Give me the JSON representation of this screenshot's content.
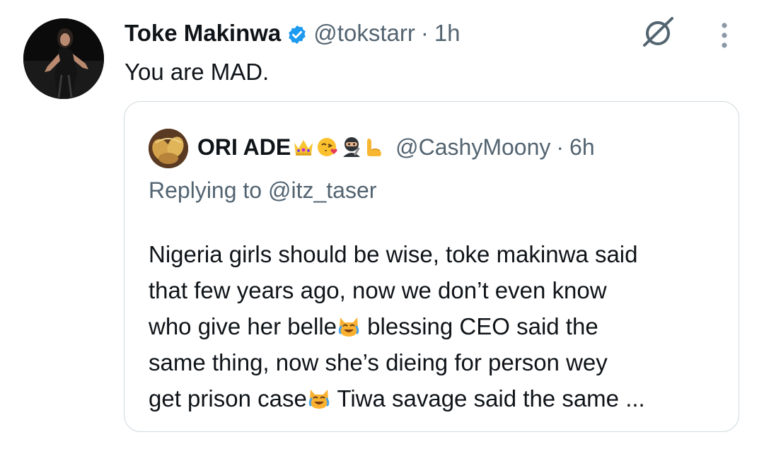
{
  "tweet": {
    "author_name": "Toke Makinwa",
    "handle": "@tokstarr",
    "separator": "·",
    "time": "1h",
    "text": "You are MAD.",
    "verified_color": "#1d9bf0",
    "icons": [
      "verified-badge-icon",
      "grok-icon",
      "more-options-icon"
    ]
  },
  "quote": {
    "author_name": "ORI ADE",
    "name_emojis": [
      "crown",
      "face-blowing-kiss",
      "ninja",
      "flexed-biceps"
    ],
    "handle": "@CashyMoony",
    "separator": "·",
    "time": "6h",
    "replying_prefix": "Replying to",
    "replying_handle": "@itz_taser",
    "lines": [
      {
        "text": "Nigeria girls should be wise, toke makinwa said"
      },
      {
        "text": "that few years ago, now we don’t even know"
      },
      {
        "before": "who give her belle",
        "emoji": "cat-with-tears-of-joy",
        "after": " blessing CEO said the"
      },
      {
        "text": "same thing, now she’s dieing for person wey"
      },
      {
        "before": "get prison case",
        "emoji": "cat-with-tears-of-joy",
        "after": " Tiwa savage said the same ..."
      }
    ]
  },
  "colors": {
    "text_primary": "#0f1419",
    "text_secondary": "#536471",
    "border": "#cfd9de",
    "accent": "#1d9bf0"
  }
}
